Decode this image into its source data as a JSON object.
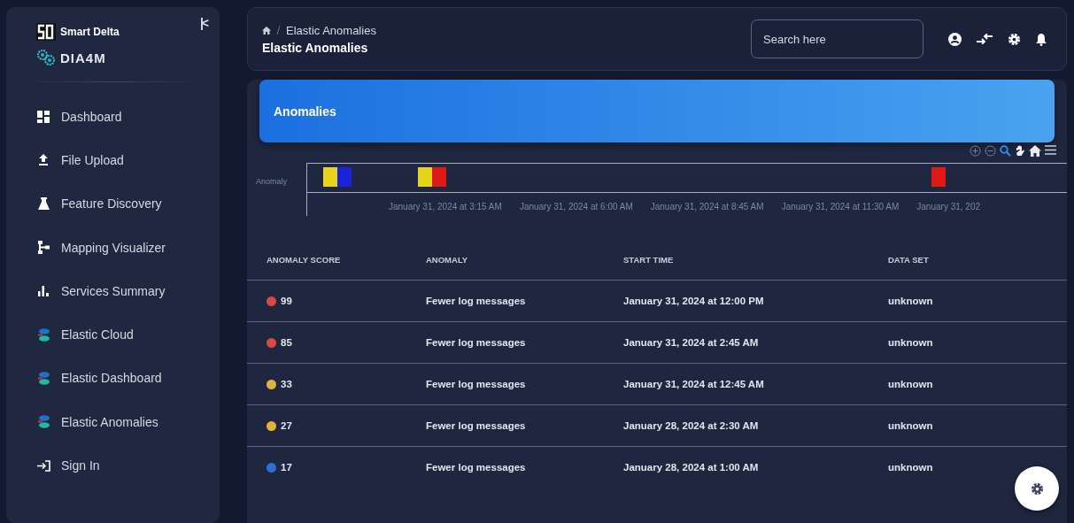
{
  "sidebar": {
    "brand": "Smart Delta",
    "product": "DIA4M",
    "collapse": "|<",
    "items": [
      {
        "label": "Dashboard"
      },
      {
        "label": "File Upload"
      },
      {
        "label": "Feature Discovery"
      },
      {
        "label": "Mapping Visualizer"
      },
      {
        "label": "Services Summary"
      },
      {
        "label": "Elastic Cloud"
      },
      {
        "label": "Elastic Dashboard"
      },
      {
        "label": "Elastic Anomalies"
      },
      {
        "label": "Sign In"
      }
    ]
  },
  "header": {
    "breadcrumb": "Elastic Anomalies",
    "title": "Elastic Anomalies",
    "search": {
      "placeholder": "Search here"
    }
  },
  "card": {
    "title": "Anomalies",
    "timeline": {
      "lane_label": "Anomaly",
      "axis_labels": [
        "January 31, 2024 at 3:15 AM",
        "January 31, 2024 at 6:00 AM",
        "January 31, 2024 at 8:45 AM",
        "January 31, 2024 at 11:30 AM",
        "January 31, 202"
      ],
      "groups": [
        {
          "cells": [
            {
              "color": "#e6d51a"
            },
            {
              "color": "#1a22e0"
            }
          ]
        },
        {
          "cells": [
            {
              "color": "#e6d51a"
            },
            {
              "color": "#e01818"
            }
          ]
        },
        {
          "cells": [
            {
              "color": "#e01818"
            }
          ]
        }
      ]
    },
    "table": {
      "columns": [
        "ANOMALY SCORE",
        "ANOMALY",
        "START TIME",
        "DATA SET"
      ],
      "rows": [
        {
          "score": "99",
          "color": "#d84a3f",
          "anomaly": "Fewer log messages",
          "start_time": "January 31, 2024 at 12:00 PM",
          "data_set": "unknown"
        },
        {
          "score": "85",
          "color": "#d84a3f",
          "anomaly": "Fewer log messages",
          "start_time": "January 31, 2024 at 2:45 AM",
          "data_set": "unknown"
        },
        {
          "score": "33",
          "color": "#e0b43a",
          "anomaly": "Fewer log messages",
          "start_time": "January 31, 2024 at 12:45 AM",
          "data_set": "unknown"
        },
        {
          "score": "27",
          "color": "#e0b43a",
          "anomaly": "Fewer log messages",
          "start_time": "January 28, 2024 at 2:30 AM",
          "data_set": "unknown"
        },
        {
          "score": "17",
          "color": "#2f6fd0",
          "anomaly": "Fewer log messages",
          "start_time": "January 28, 2024 at 1:00 AM",
          "data_set": "unknown"
        }
      ]
    }
  }
}
